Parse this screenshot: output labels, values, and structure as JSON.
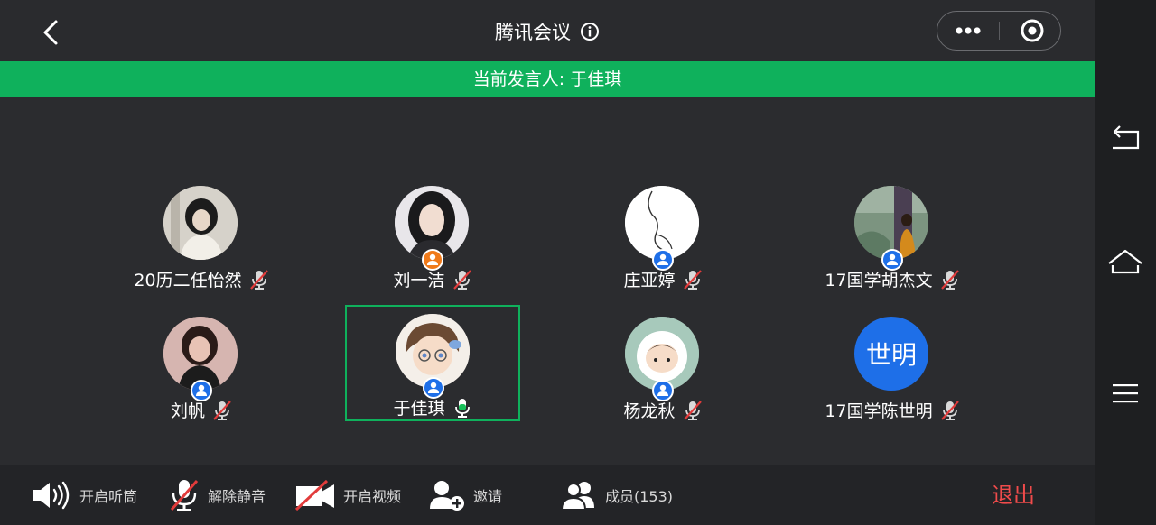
{
  "header": {
    "title": "腾讯会议"
  },
  "banner": {
    "speaker_text": "当前发言人: 于佳琪"
  },
  "participants": [
    {
      "name": "20历二任怡然",
      "mic": "muted",
      "avatar_bg": "#c9c4bb"
    },
    {
      "name": "刘一洁",
      "mic": "muted",
      "avatar_bg": "#b9b7bf",
      "badge": "orange"
    },
    {
      "name": "庄亚婷",
      "mic": "muted",
      "avatar_bg": "#ffffff",
      "badge": "blue"
    },
    {
      "name": "17国学胡杰文",
      "mic": "muted",
      "avatar_bg": "#6f8a78",
      "badge": "blue"
    },
    {
      "name": "刘帆",
      "mic": "muted",
      "avatar_bg": "#caa8a5",
      "badge": "blue"
    },
    {
      "name": "于佳琪",
      "mic": "active",
      "avatar_bg": "#efe9e2",
      "badge": "blue",
      "active": true
    },
    {
      "name": "杨龙秋",
      "mic": "muted",
      "avatar_bg": "#9fc4b5",
      "badge": "blue"
    },
    {
      "name": "17国学陈世明",
      "mic": "muted",
      "avatar_text": "世明",
      "avatar_bg": "#1e6fe8"
    }
  ],
  "bottombar": {
    "speaker": "开启听筒",
    "unmute": "解除静音",
    "video": "开启视频",
    "invite": "邀请",
    "members": "成员(153)",
    "exit": "退出"
  },
  "colors": {
    "accent_green": "#0fb15c",
    "exit_red": "#f04b4b",
    "badge_blue": "#1e6fe8",
    "badge_orange": "#f07a1a"
  }
}
